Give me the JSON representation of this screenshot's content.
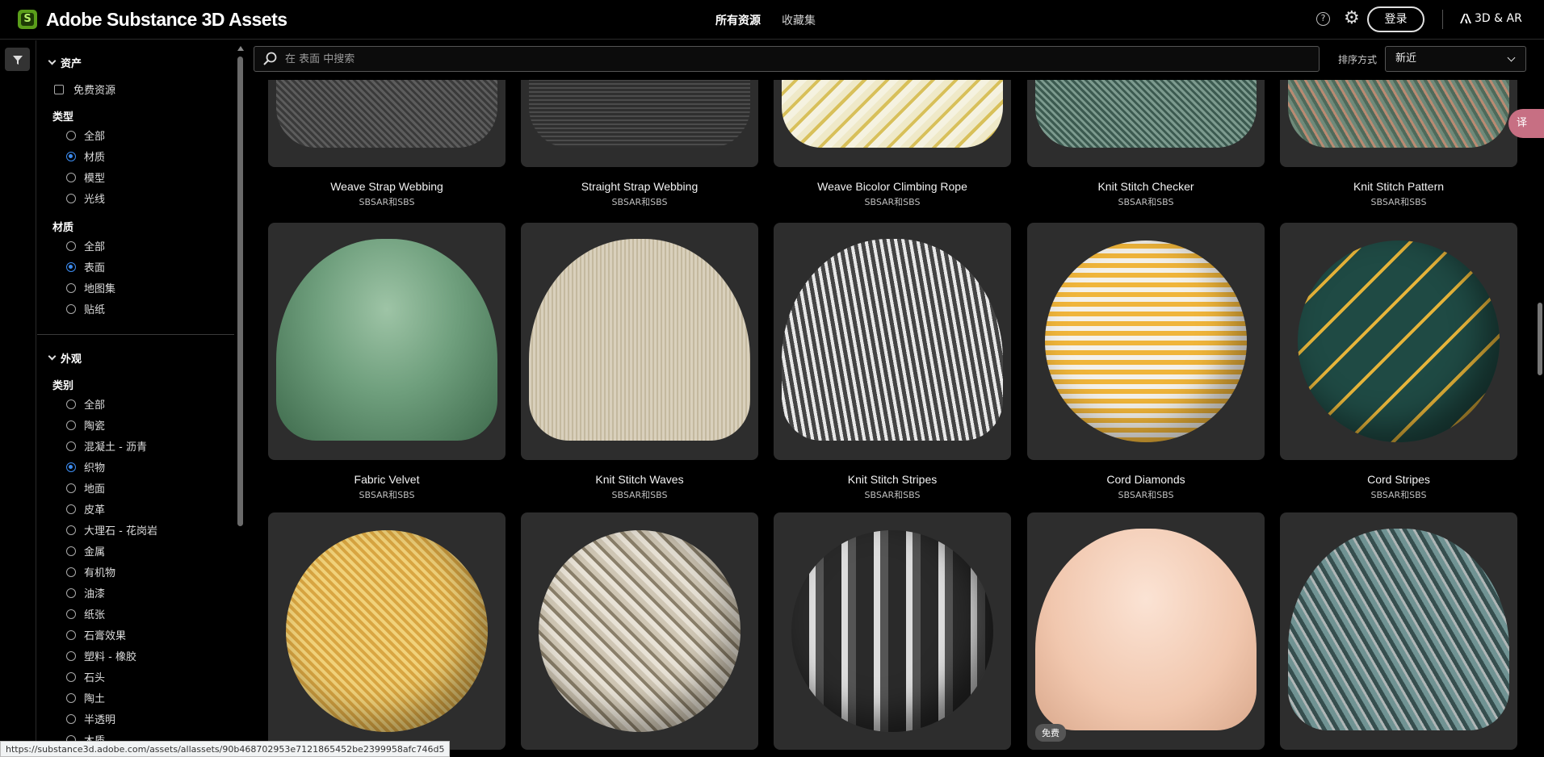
{
  "header": {
    "brand": "Adobe Substance 3D Assets",
    "logo_letter": "S",
    "nav": [
      "所有资源",
      "收藏集"
    ],
    "help": "?",
    "login": "登录",
    "ar": "3D & AR"
  },
  "sidebar": {
    "assets_title": "资产",
    "free_label": "免费资源",
    "type_label": "类型",
    "type_options": [
      "全部",
      "材质",
      "模型",
      "光线"
    ],
    "material_label": "材质",
    "material_options": [
      "全部",
      "表面",
      "地图集",
      "贴纸"
    ],
    "appearance_title": "外观",
    "category_label": "类别",
    "category_options": [
      "全部",
      "陶瓷",
      "混凝土 - 沥青",
      "织物",
      "地面",
      "皮革",
      "大理石 - 花岗岩",
      "金属",
      "有机物",
      "油漆",
      "纸张",
      "石膏效果",
      "塑料 - 橡胶",
      "石头",
      "陶土",
      "半透明",
      "木质"
    ]
  },
  "search": {
    "placeholder": "在 表面 中搜索",
    "sort_label": "排序方式",
    "sort_value": "新近"
  },
  "cards": [
    {
      "name": "Weave Strap Webbing",
      "type": "SBSAR和SBS"
    },
    {
      "name": "Straight Strap Webbing",
      "type": "SBSAR和SBS"
    },
    {
      "name": "Weave Bicolor Climbing Rope",
      "type": "SBSAR和SBS"
    },
    {
      "name": "Knit Stitch Checker",
      "type": "SBSAR和SBS"
    },
    {
      "name": "Knit Stitch Pattern",
      "type": "SBSAR和SBS"
    },
    {
      "name": "Fabric Velvet",
      "type": "SBSAR和SBS"
    },
    {
      "name": "Knit Stitch Waves",
      "type": "SBSAR和SBS"
    },
    {
      "name": "Knit Stitch Stripes",
      "type": "SBSAR和SBS"
    },
    {
      "name": "Cord Diamonds",
      "type": "SBSAR和SBS"
    },
    {
      "name": "Cord Stripes",
      "type": "SBSAR和SBS"
    }
  ],
  "free_badge": "免费",
  "translate_label": "译",
  "status_url": "https://substance3d.adobe.com/assets/allassets/90b468702953e7121865452be2399958afc746d5",
  "colors": {
    "accent": "#3d8cf0",
    "card_bg": "#2d2d2d",
    "brand_green": "#5a9e1a"
  }
}
